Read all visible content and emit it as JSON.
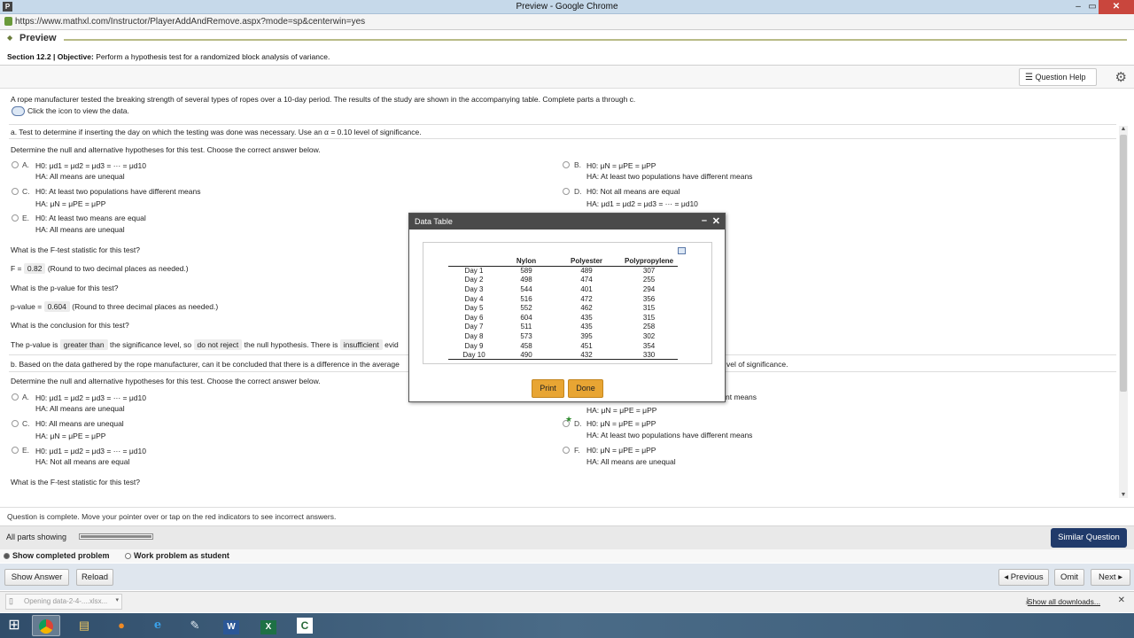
{
  "browser": {
    "window_title": "Preview - Google Chrome",
    "app_icon": "P",
    "url": "https://www.mathxl.com/Instructor/PlayerAddAndRemove.aspx?mode=sp&centerwin=yes",
    "controls": {
      "minimize": "–",
      "restore": "▭",
      "close": "✕"
    }
  },
  "header": {
    "preview_label": "Preview",
    "section": "Section 12.2",
    "objective_prefix": "| Objective:",
    "objective_text": "Perform a hypothesis test for a randomized block analysis of variance.",
    "question_help": "Question Help"
  },
  "question": {
    "intro": "A rope manufacturer tested the breaking strength of several types of ropes over a 10-day period. The results of the study are shown in the accompanying table. Complete parts a through c.",
    "click_icon": "Click the icon to view the data.",
    "part_a": "a. Test to determine if inserting the day on which the testing was done was necessary. Use an α = 0.10 level of significance.",
    "determine_a": "Determine the null and alternative hypotheses for this test. Choose the correct answer below.",
    "options_a": {
      "A": {
        "letter": "A.",
        "h0": "H0: μd1 = μd2 = μd3 = ··· = μd10",
        "ha": "HA: All means are unequal"
      },
      "B": {
        "letter": "B.",
        "h0": "H0: μN = μPE = μPP",
        "ha": "HA: At least two populations have different means"
      },
      "C": {
        "letter": "C.",
        "h0": "H0: At least two populations have different means",
        "ha": "HA: μN = μPE = μPP"
      },
      "D": {
        "letter": "D.",
        "h0": "H0: Not all means are equal",
        "ha": "HA: μd1 = μd2 = μd3 = ··· = μd10"
      },
      "E": {
        "letter": "E.",
        "h0": "H0: At least two means are equal",
        "ha": "HA: All means are unequal"
      }
    },
    "f_question": "What is the F-test statistic for this test?",
    "f_prefix": "F =",
    "f_value": "0.82",
    "f_round": "(Round to two decimal places as needed.)",
    "p_question": "What is the p-value for this test?",
    "p_prefix": "p-value =",
    "p_value": "0.604",
    "p_round": "(Round to three decimal places as needed.)",
    "conclusion_q": "What is the conclusion for this test?",
    "concl_1": "The p-value is",
    "concl_ans1": "greater than",
    "concl_2": "the significance level, so",
    "concl_ans2": "do not reject",
    "concl_3": "the null hypothesis. There is",
    "concl_ans3": "insufficient",
    "concl_4": "evid",
    "part_b": "b. Based on the data gathered by the rope manufacturer, can it be concluded that there is a difference in the average",
    "part_b_tail": "vel of significance.",
    "determine_b": "Determine the null and alternative hypotheses for this test. Choose the correct answer below.",
    "options_b": {
      "A": {
        "letter": "A.",
        "h0": "H0: μd1 = μd2 = μd3 = ··· = μd10",
        "ha": "HA: All means are unequal"
      },
      "B_tail": "nt means",
      "B_ha": "HA: μN = μPE = μPP",
      "C": {
        "letter": "C.",
        "h0": "H0: All means are unequal",
        "ha": "HA: μN = μPE = μPP"
      },
      "D": {
        "letter": "D.",
        "h0": "H0: μN = μPE = μPP",
        "ha": "HA: At least two populations have different means"
      },
      "E": {
        "letter": "E.",
        "h0": "H0: μd1 = μd2 = μd3 = ··· = μd10",
        "ha": "HA: Not all means are equal"
      },
      "F": {
        "letter": "F.",
        "h0": "H0: μN = μPE = μPP",
        "ha": "HA: All means are unequal"
      }
    },
    "f_question_b": "What is the F-test statistic for this test?"
  },
  "data_table": {
    "title": "Data Table",
    "columns": [
      "",
      "Nylon",
      "Polyester",
      "Polypropylene"
    ],
    "rows": [
      [
        "Day 1",
        "589",
        "489",
        "307"
      ],
      [
        "Day 2",
        "498",
        "474",
        "255"
      ],
      [
        "Day 3",
        "544",
        "401",
        "294"
      ],
      [
        "Day 4",
        "516",
        "472",
        "356"
      ],
      [
        "Day 5",
        "552",
        "462",
        "315"
      ],
      [
        "Day 6",
        "604",
        "435",
        "315"
      ],
      [
        "Day 7",
        "511",
        "435",
        "258"
      ],
      [
        "Day 8",
        "573",
        "395",
        "302"
      ],
      [
        "Day 9",
        "458",
        "451",
        "354"
      ],
      [
        "Day 10",
        "490",
        "432",
        "330"
      ]
    ],
    "print_label": "Print",
    "done_label": "Done"
  },
  "status": {
    "complete_msg": "Question is complete. Move your pointer over or tap on the red indicators to see incorrect answers.",
    "parts_label": "All parts showing",
    "parts_progress": 1.0,
    "similar_question": "Similar Question",
    "show_completed": "Show completed problem",
    "work_as_student": "Work problem as student"
  },
  "buttons": {
    "show_answer": "Show Answer",
    "reload": "Reload",
    "previous": "◂ Previous",
    "omit": "Omit",
    "next": "Next ▸"
  },
  "downloads": {
    "item": "Opening data-2-4-....xlsx...",
    "show_all": "Show all downloads...",
    "close": "✕"
  },
  "taskbar": {
    "icons": [
      "windows-start-icon",
      "chrome-icon",
      "file-explorer-icon",
      "firefox-icon",
      "internet-explorer-icon",
      "notes-icon",
      "word-icon",
      "excel-icon",
      "camtasia-icon"
    ]
  }
}
